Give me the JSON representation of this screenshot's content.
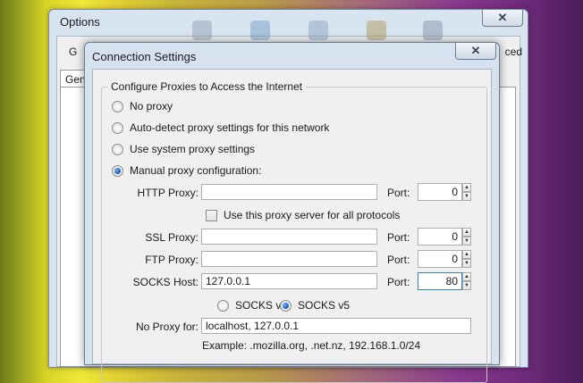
{
  "options_window": {
    "title": "Options",
    "close_glyph": "✕",
    "label_left": "G",
    "label_right": "ced",
    "tab_label": "Gen"
  },
  "dialog": {
    "title": "Connection Settings",
    "close_glyph": "✕",
    "group_title": "Configure Proxies to Access the Internet",
    "radios": {
      "no_proxy": "No proxy",
      "auto_detect": "Auto-detect proxy settings for this network",
      "system": "Use system proxy settings",
      "manual": "Manual proxy configuration:"
    },
    "selected_mode": "manual",
    "http": {
      "label": "HTTP Proxy:",
      "value": "",
      "port_label": "Port:",
      "port": "0"
    },
    "same_proxy_checkbox": {
      "label": "Use this proxy server for all protocols",
      "checked": false
    },
    "ssl": {
      "label": "SSL Proxy:",
      "value": "",
      "port_label": "Port:",
      "port": "0"
    },
    "ftp": {
      "label": "FTP Proxy:",
      "value": "",
      "port_label": "Port:",
      "port": "0"
    },
    "socks": {
      "label": "SOCKS Host:",
      "value": "127.0.0.1",
      "port_label": "Port:",
      "port": "80"
    },
    "socks_version": {
      "v4": "SOCKS v4",
      "v5": "SOCKS v5",
      "selected": "v5"
    },
    "no_proxy_for": {
      "label": "No Proxy for:",
      "value": "localhost, 127.0.0.1"
    },
    "example": "Example: .mozilla.org, .net.nz, 192.168.1.0/24"
  },
  "icons": {
    "spin_up": "▲",
    "spin_down": "▼"
  }
}
